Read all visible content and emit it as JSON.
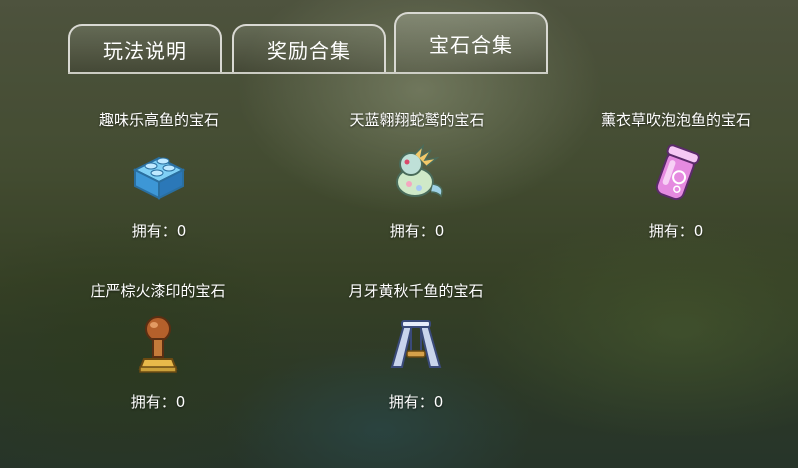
{
  "tabs": [
    {
      "label": "玩法说明",
      "active": false
    },
    {
      "label": "奖励合集",
      "active": false
    },
    {
      "label": "宝石合集",
      "active": true
    }
  ],
  "own_label": "拥有：",
  "gems": [
    {
      "title": "趣味乐高鱼的宝石",
      "count": "0",
      "icon": "blue-brick-icon"
    },
    {
      "title": "天蓝翱翔蛇鹫的宝石",
      "count": "0",
      "icon": "dragon-bird-icon"
    },
    {
      "title": "薰衣草吹泡泡鱼的宝石",
      "count": "0",
      "icon": "bubble-jar-icon"
    },
    {
      "title": "庄严棕火漆印的宝石",
      "count": "0",
      "icon": "wax-seal-stamp-icon"
    },
    {
      "title": "月牙黄秋千鱼的宝石",
      "count": "0",
      "icon": "swing-icon"
    }
  ]
}
